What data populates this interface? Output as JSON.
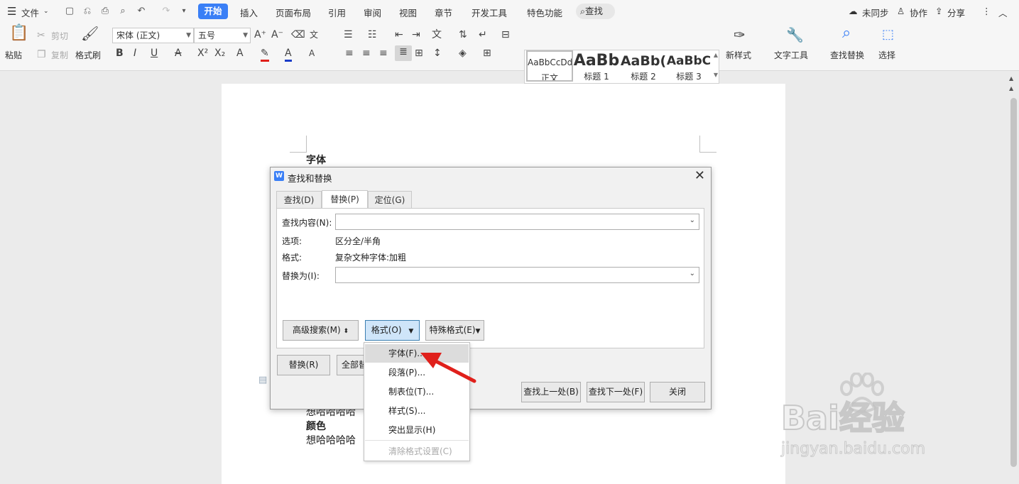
{
  "menubar": {
    "file_label": "文件",
    "tabs": [
      "开始",
      "插入",
      "页面布局",
      "引用",
      "审阅",
      "视图",
      "章节",
      "开发工具",
      "特色功能"
    ],
    "active_tab": "开始",
    "search_label": "查找",
    "sync_label": "未同步",
    "collab_label": "协作",
    "share_label": "分享"
  },
  "ribbon": {
    "paste": "粘贴",
    "cut": "剪切",
    "copy": "复制",
    "format_painter": "格式刷",
    "font_name": "宋体 (正文)",
    "font_size": "五号",
    "styles": [
      {
        "preview": "AaBbCcDd",
        "name": "正文"
      },
      {
        "preview": "AaBb",
        "name": "标题 1"
      },
      {
        "preview": "AaBb(",
        "name": "标题 2"
      },
      {
        "preview": "AaBbC",
        "name": "标题 3"
      }
    ],
    "new_style": "新样式",
    "text_tools": "文字工具",
    "find_replace": "查找替换",
    "select": "选择"
  },
  "document": {
    "heading1": "字体",
    "line1": "想哈哈哈哈",
    "heading2": "颜色",
    "line2": "想哈哈哈哈"
  },
  "dialog": {
    "title": "查找和替换",
    "tabs": [
      "查找(D)",
      "替换(P)",
      "定位(G)"
    ],
    "active_tab": "替换(P)",
    "find_label": "查找内容(N):",
    "find_value": "",
    "options_label": "选项:",
    "options_value": "区分全/半角",
    "format_label": "格式:",
    "format_value": "复杂文种字体:加粗",
    "replace_label": "替换为(I):",
    "replace_value": "",
    "btn_advanced": "高级搜索(M)",
    "btn_format": "格式(O)",
    "btn_special": "特殊格式(E)",
    "btn_replace": "替换(R)",
    "btn_replace_all": "全部替",
    "btn_find_prev": "查找上一处(B)",
    "btn_find_next": "查找下一处(F)",
    "btn_close": "关闭"
  },
  "format_menu": {
    "items": [
      "字体(F)...",
      "段落(P)...",
      "制表位(T)...",
      "样式(S)...",
      "突出显示(H)",
      "清除格式设置(C)"
    ],
    "highlighted": "字体(F)..."
  },
  "watermark": {
    "brand": "Bai经验",
    "url": "jingyan.baidu.com"
  },
  "colors": {
    "accent": "#3a7ff6",
    "arrow": "#e0201b"
  }
}
